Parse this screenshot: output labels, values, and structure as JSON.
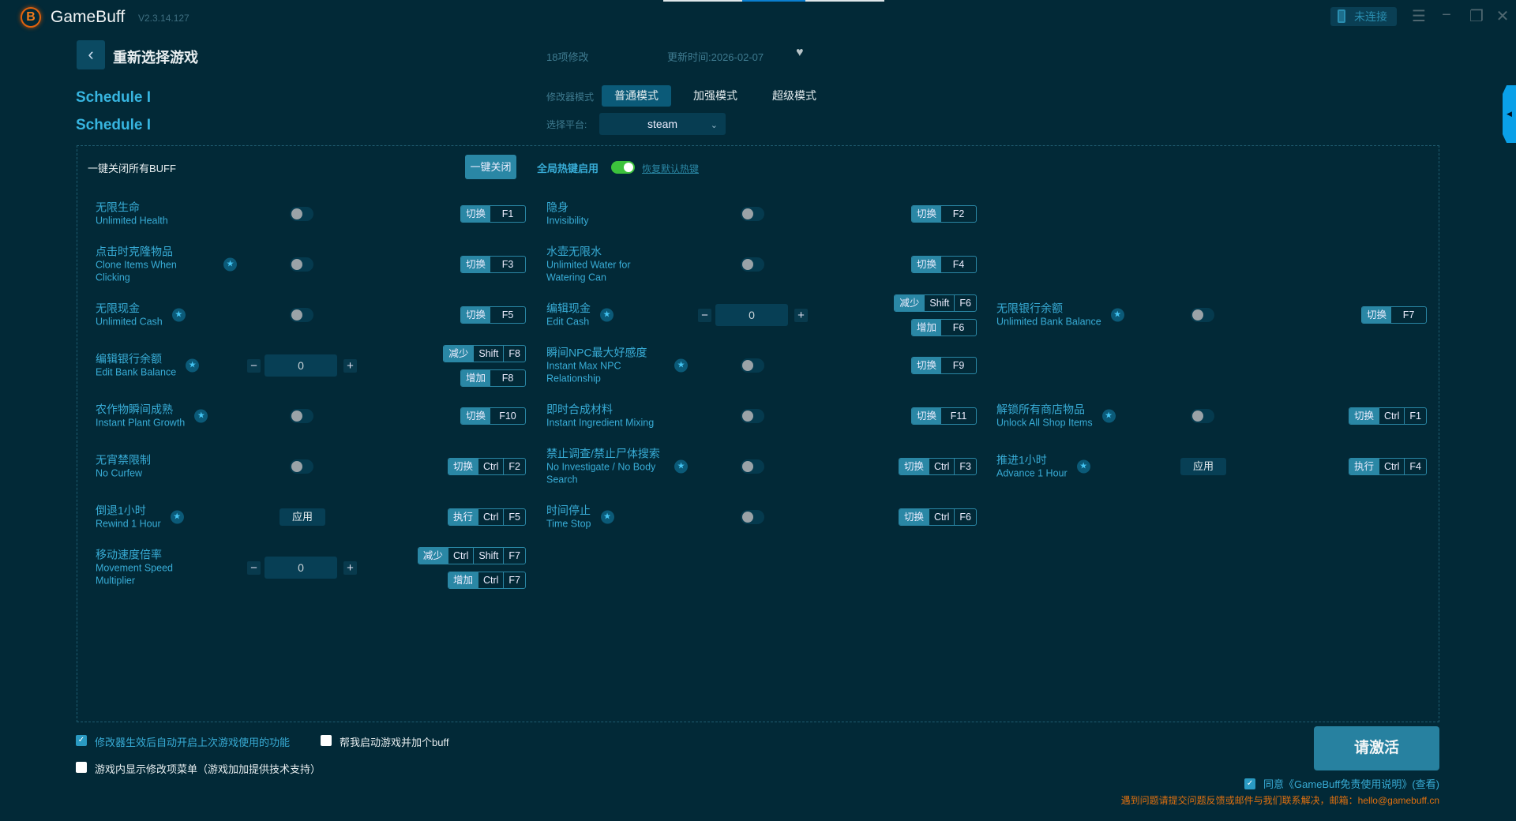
{
  "app": {
    "name": "GameBuff",
    "version": "V2.3.14.127",
    "logo_letter": "B"
  },
  "titlebar": {
    "connect_label": "未连接",
    "menu_icon": "☰",
    "minimize_icon": "−",
    "restore_icon": "❐",
    "close_icon": "✕"
  },
  "header": {
    "back_label": "重新选择游戏",
    "mod_count": "18项修改",
    "updated": "更新时间:2026-02-07",
    "heart_icon": "♥"
  },
  "game": {
    "title": "Schedule I",
    "subtitle": "Schedule I"
  },
  "mode": {
    "label": "修改器模式",
    "options": [
      "普通模式",
      "加强模式",
      "超级模式"
    ],
    "selected": "普通模式"
  },
  "platform": {
    "label": "选择平台:",
    "value": "steam"
  },
  "controls": {
    "close_all_label": "一键关闭所有BUFF",
    "close_all_button": "一键关闭",
    "global_hotkey_label": "全局热键启用",
    "global_hotkey_on": true,
    "restore_hotkeys": "恢复默认热键"
  },
  "rows": [
    [
      {
        "zh": "无限生命",
        "en": "Unlimited Health",
        "star": false,
        "control": "toggle",
        "hotkeys": [
          {
            "action": "切换",
            "keys": [
              "F1"
            ]
          }
        ]
      },
      {
        "zh": "隐身",
        "en": "Invisibility",
        "star": false,
        "control": "toggle",
        "hotkeys": [
          {
            "action": "切换",
            "keys": [
              "F2"
            ]
          }
        ]
      },
      null
    ],
    [
      {
        "zh": "点击时克隆物品",
        "en": "Clone Items When Clicking",
        "star": true,
        "control": "toggle",
        "hotkeys": [
          {
            "action": "切换",
            "keys": [
              "F3"
            ]
          }
        ]
      },
      {
        "zh": "水壶无限水",
        "en": "Unlimited Water for Watering Can",
        "star": false,
        "control": "toggle",
        "hotkeys": [
          {
            "action": "切换",
            "keys": [
              "F4"
            ]
          }
        ]
      },
      null
    ],
    [
      {
        "zh": "无限现金",
        "en": "Unlimited Cash",
        "star": true,
        "control": "toggle",
        "hotkeys": [
          {
            "action": "切换",
            "keys": [
              "F5"
            ]
          }
        ]
      },
      {
        "zh": "编辑现金",
        "en": "Edit Cash",
        "star": true,
        "control": "stepper",
        "value": "0",
        "hotkeys": [
          {
            "action": "减少",
            "keys": [
              "Shift",
              "F6"
            ]
          },
          {
            "action": "增加",
            "keys": [
              "F6"
            ]
          }
        ]
      },
      {
        "zh": "无限银行余额",
        "en": "Unlimited Bank Balance",
        "star": true,
        "control": "toggle",
        "hotkeys": [
          {
            "action": "切换",
            "keys": [
              "F7"
            ]
          }
        ]
      }
    ],
    [
      {
        "zh": "编辑银行余额",
        "en": "Edit Bank Balance",
        "star": true,
        "control": "stepper",
        "value": "0",
        "hotkeys": [
          {
            "action": "减少",
            "keys": [
              "Shift",
              "F8"
            ]
          },
          {
            "action": "增加",
            "keys": [
              "F8"
            ]
          }
        ]
      },
      {
        "zh": "瞬间NPC最大好感度",
        "en": "Instant Max NPC Relationship",
        "star": true,
        "control": "toggle",
        "hotkeys": [
          {
            "action": "切换",
            "keys": [
              "F9"
            ]
          }
        ]
      },
      null
    ],
    [
      {
        "zh": "农作物瞬间成熟",
        "en": "Instant Plant Growth",
        "star": true,
        "control": "toggle",
        "hotkeys": [
          {
            "action": "切换",
            "keys": [
              "F10"
            ]
          }
        ]
      },
      {
        "zh": "即时合成材料",
        "en": "Instant Ingredient Mixing",
        "star": false,
        "control": "toggle",
        "hotkeys": [
          {
            "action": "切换",
            "keys": [
              "F11"
            ]
          }
        ]
      },
      {
        "zh": "解锁所有商店物品",
        "en": "Unlock All Shop Items",
        "star": true,
        "control": "toggle",
        "hotkeys": [
          {
            "action": "切换",
            "keys": [
              "Ctrl",
              "F1"
            ]
          }
        ]
      }
    ],
    [
      {
        "zh": "无宵禁限制",
        "en": "No Curfew",
        "star": false,
        "control": "toggle",
        "hotkeys": [
          {
            "action": "切换",
            "keys": [
              "Ctrl",
              "F2"
            ]
          }
        ]
      },
      {
        "zh": "禁止调查/禁止尸体搜索",
        "en": "No Investigate / No Body Search",
        "star": true,
        "control": "toggle",
        "hotkeys": [
          {
            "action": "切换",
            "keys": [
              "Ctrl",
              "F3"
            ]
          }
        ]
      },
      {
        "zh": "推进1小时",
        "en": "Advance 1 Hour",
        "star": true,
        "control": "apply",
        "apply_label": "应用",
        "hotkeys": [
          {
            "action": "执行",
            "keys": [
              "Ctrl",
              "F4"
            ]
          }
        ]
      }
    ],
    [
      {
        "zh": "倒退1小时",
        "en": "Rewind 1 Hour",
        "star": true,
        "control": "apply",
        "apply_label": "应用",
        "hotkeys": [
          {
            "action": "执行",
            "keys": [
              "Ctrl",
              "F5"
            ]
          }
        ]
      },
      {
        "zh": "时间停止",
        "en": "Time Stop",
        "star": true,
        "control": "toggle",
        "hotkeys": [
          {
            "action": "切换",
            "keys": [
              "Ctrl",
              "F6"
            ]
          }
        ]
      },
      null
    ],
    [
      {
        "zh": "移动速度倍率",
        "en": "Movement Speed Multiplier",
        "star": false,
        "control": "stepper",
        "value": "0",
        "hotkeys": [
          {
            "action": "减少",
            "keys": [
              "Ctrl",
              "Shift",
              "F7"
            ]
          },
          {
            "action": "增加",
            "keys": [
              "Ctrl",
              "F7"
            ]
          }
        ]
      },
      null,
      null
    ]
  ],
  "footer": {
    "opt_auto_enable": "修改器生效后自动开启上次游戏使用的功能",
    "opt_auto_enable_checked": true,
    "opt_launch_game": "帮我启动游戏并加个buff",
    "opt_launch_game_checked": false,
    "opt_ingame_menu": "游戏内显示修改项菜单（游戏加加提供技术支持）",
    "opt_ingame_menu_checked": false,
    "activate_label": "请激活",
    "agree_text": "同意《GameBuff免责使用说明》(查看)",
    "agree_checked": true,
    "contact": "遇到问题请提交问题反馈或邮件与我们联系解决，邮箱：hello@gamebuff.cn"
  },
  "colors": {
    "background": "#022937",
    "accent": "#2a87a5",
    "text_cyan": "#38acd6",
    "warning": "#e0700f",
    "toggle_on": "#3cc23c"
  }
}
